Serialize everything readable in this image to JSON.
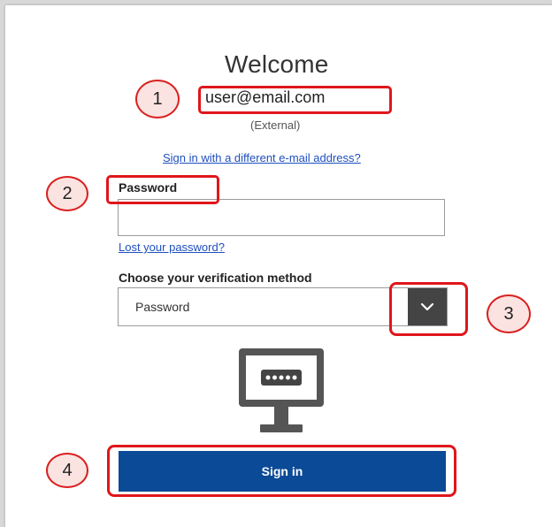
{
  "header": {
    "title": "Welcome",
    "email": "user@email.com",
    "account_type": "(External)"
  },
  "links": {
    "different_email": "Sign in with a different e-mail address?",
    "lost_password": "Lost your password?"
  },
  "form": {
    "password_label": "Password",
    "password_value": "",
    "verification_label": "Choose your verification method",
    "verification_selected": "Password",
    "submit_label": "Sign in"
  },
  "icons": {
    "dropdown": "chevron-down-icon",
    "method_illustration": "monitor-password-icon"
  },
  "annotations": {
    "markers": [
      "1",
      "2",
      "3",
      "4"
    ],
    "highlight_color": "#e0161b",
    "marker_fill": "#fbe3e1"
  },
  "colors": {
    "primary_button": "#0b4a96",
    "link": "#1f4fbf",
    "dropdown_button": "#444444"
  }
}
